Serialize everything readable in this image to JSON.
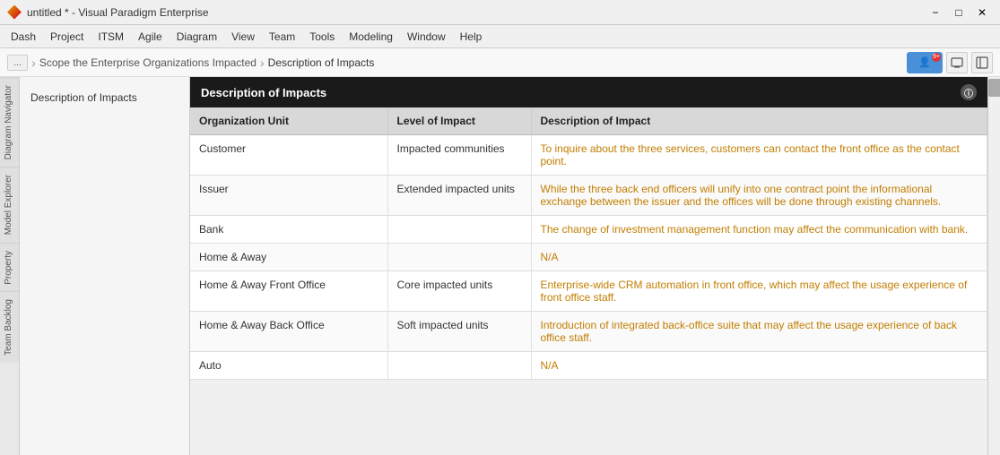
{
  "titlebar": {
    "title": "untitled * - Visual Paradigm Enterprise",
    "controls": {
      "minimize": "−",
      "maximize": "□",
      "close": "✕"
    }
  },
  "menubar": {
    "items": [
      "Dash",
      "Project",
      "ITSM",
      "Agile",
      "Diagram",
      "View",
      "Team",
      "Tools",
      "Modeling",
      "Window",
      "Help"
    ]
  },
  "breadcrumb": {
    "nav_btn": "...",
    "items": [
      "Scope the Enterprise Organizations Impacted",
      "Description of Impacts"
    ]
  },
  "sidebar_tabs": [
    "Diagram Navigator",
    "Model Explorer",
    "Property",
    "Team Backlog"
  ],
  "section_header": "Description of Impacts",
  "table": {
    "columns": [
      "Organization Unit",
      "Level of Impact",
      "Description of Impact"
    ],
    "rows": [
      {
        "org_unit": "Customer",
        "level": "Impacted communities",
        "description": "To inquire about the three services, customers can contact the front office as the contact point."
      },
      {
        "org_unit": "Issuer",
        "level": "Extended impacted units",
        "description": "While the three back end officers will unify into one contract point the informational exchange between the issuer and the offices will be done through existing channels."
      },
      {
        "org_unit": "Bank",
        "level": "",
        "description": "The change of investment management function may affect the communication with bank."
      },
      {
        "org_unit": "Home & Away",
        "level": "",
        "description": "N/A"
      },
      {
        "org_unit": "Home & Away Front Office",
        "level": "Core impacted units",
        "description": "Enterprise-wide CRM automation in front office, which may affect the usage experience of front office staff."
      },
      {
        "org_unit": "Home & Away Back Office",
        "level": "Soft impacted units",
        "description": "Introduction of integrated back-office suite that may affect the usage experience of back office staff."
      },
      {
        "org_unit": "Auto",
        "level": "",
        "description": "N/A"
      }
    ]
  },
  "left_panel_label": "Description of Impacts"
}
